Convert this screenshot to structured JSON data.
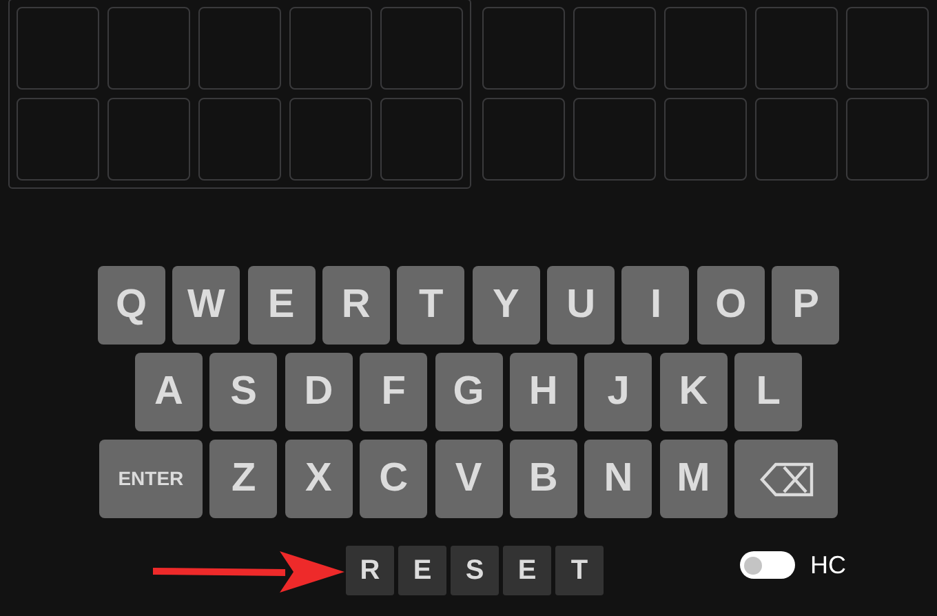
{
  "boards": [
    {
      "bordered": true
    },
    {
      "bordered": false
    }
  ],
  "keyboard": [
    [
      {
        "kind": "letter",
        "label": "Q"
      },
      {
        "kind": "letter",
        "label": "W"
      },
      {
        "kind": "letter",
        "label": "E"
      },
      {
        "kind": "letter",
        "label": "R"
      },
      {
        "kind": "letter",
        "label": "T"
      },
      {
        "kind": "letter",
        "label": "Y"
      },
      {
        "kind": "letter",
        "label": "U"
      },
      {
        "kind": "letter",
        "label": "I"
      },
      {
        "kind": "letter",
        "label": "O"
      },
      {
        "kind": "letter",
        "label": "P"
      }
    ],
    [
      {
        "kind": "letter",
        "label": "A"
      },
      {
        "kind": "letter",
        "label": "S"
      },
      {
        "kind": "letter",
        "label": "D"
      },
      {
        "kind": "letter",
        "label": "F"
      },
      {
        "kind": "letter",
        "label": "G"
      },
      {
        "kind": "letter",
        "label": "H"
      },
      {
        "kind": "letter",
        "label": "J"
      },
      {
        "kind": "letter",
        "label": "K"
      },
      {
        "kind": "letter",
        "label": "L"
      }
    ],
    [
      {
        "kind": "enter",
        "label": "ENTER"
      },
      {
        "kind": "letter",
        "label": "Z"
      },
      {
        "kind": "letter",
        "label": "X"
      },
      {
        "kind": "letter",
        "label": "C"
      },
      {
        "kind": "letter",
        "label": "V"
      },
      {
        "kind": "letter",
        "label": "B"
      },
      {
        "kind": "letter",
        "label": "N"
      },
      {
        "kind": "letter",
        "label": "M"
      },
      {
        "kind": "backspace"
      }
    ]
  ],
  "reset_tiles": [
    "R",
    "E",
    "S",
    "E",
    "T"
  ],
  "toggle": {
    "label": "HC",
    "on": false
  }
}
